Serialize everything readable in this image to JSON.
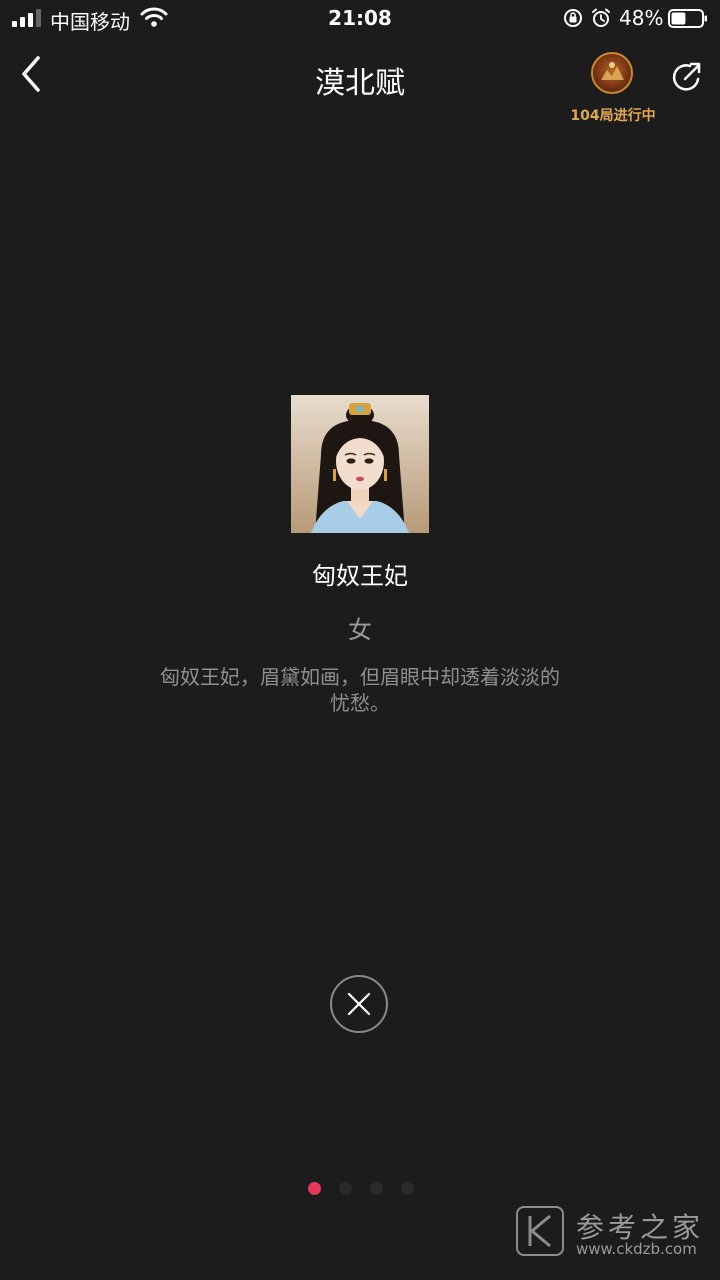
{
  "status_bar": {
    "carrier": "中国移动",
    "time": "21:08",
    "battery_percent": "48%",
    "battery_level": 0.48
  },
  "header": {
    "title": "漠北赋",
    "game_badge_label": "104局进行中"
  },
  "character": {
    "name": "匈奴王妃",
    "gender": "女",
    "description": "匈奴王妃，眉黛如画，但眉眼中却透着淡淡的忧愁。"
  },
  "pager": {
    "count": 4,
    "active_index": 0,
    "active_color": "#e8385a"
  },
  "watermark": {
    "title": "参考之家",
    "url": "www.ckdzb.com"
  }
}
